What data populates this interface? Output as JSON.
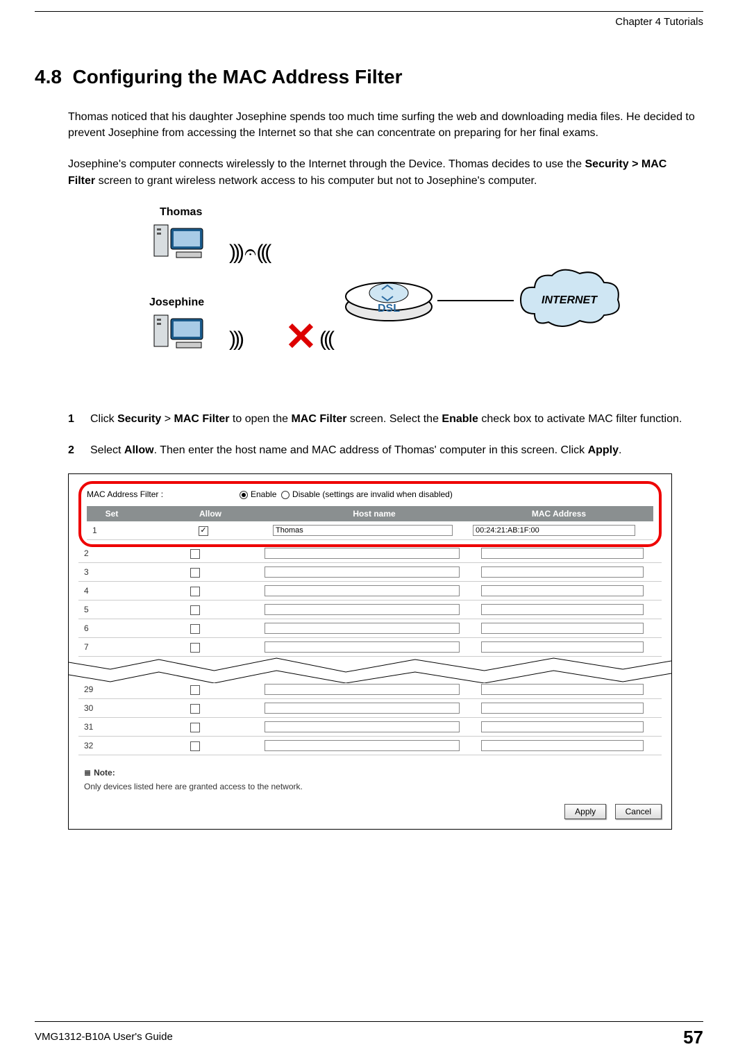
{
  "header": {
    "chapter": "Chapter 4 Tutorials"
  },
  "section": {
    "number": "4.8",
    "title": "Configuring the MAC Address Filter"
  },
  "para1_a": "Thomas noticed that his daughter Josephine spends too much time surfing the web and downloading media files. He decided to prevent Josephine from accessing the Internet so that she can concentrate on preparing for her final exams.",
  "para2_a": "Josephine's computer connects wirelessly to the Internet through the Device. Thomas decides to use the ",
  "para2_bold": "Security > MAC Filter",
  "para2_b": " screen to grant wireless network access to his computer but not to Josephine's computer.",
  "diagram": {
    "label_thomas": "Thomas",
    "label_josephine": "Josephine",
    "dsl_label": "DSL",
    "cloud_label": "INTERNET"
  },
  "steps": {
    "s1": {
      "num": "1",
      "a": "Click ",
      "b1": "Security",
      "mid1": " > ",
      "b2": "MAC Filter",
      "c": " to open the ",
      "b3": "MAC Filter",
      "d": " screen. Select the ",
      "b4": "Enable",
      "e": " check box to activate MAC filter function."
    },
    "s2": {
      "num": "2",
      "a": "Select ",
      "b1": "Allow",
      "b": ". Then enter the host name and MAC address of Thomas' computer in this screen. Click ",
      "b2": "Apply",
      "c": "."
    }
  },
  "panel": {
    "filter_label": "MAC Address Filter :",
    "enable": "Enable",
    "disable": "Disable (settings are invalid when disabled)",
    "head_set": "Set",
    "head_allow": "Allow",
    "head_host": "Host name",
    "head_mac": "MAC Address",
    "rows_top": [
      {
        "set": "1",
        "allow": true,
        "host": "Thomas",
        "mac": "00:24:21:AB:1F:00"
      },
      {
        "set": "2",
        "allow": false,
        "host": "",
        "mac": ""
      },
      {
        "set": "3",
        "allow": false,
        "host": "",
        "mac": ""
      },
      {
        "set": "4",
        "allow": false,
        "host": "",
        "mac": ""
      },
      {
        "set": "5",
        "allow": false,
        "host": "",
        "mac": ""
      },
      {
        "set": "6",
        "allow": false,
        "host": "",
        "mac": ""
      },
      {
        "set": "7",
        "allow": false,
        "host": "",
        "mac": ""
      }
    ],
    "rows_bottom": [
      {
        "set": "29",
        "allow": false,
        "host": "",
        "mac": ""
      },
      {
        "set": "30",
        "allow": false,
        "host": "",
        "mac": ""
      },
      {
        "set": "31",
        "allow": false,
        "host": "",
        "mac": ""
      },
      {
        "set": "32",
        "allow": false,
        "host": "",
        "mac": ""
      }
    ],
    "note_title": "Note:",
    "note_body": "Only devices listed here are granted access to the network.",
    "btn_apply": "Apply",
    "btn_cancel": "Cancel"
  },
  "footer": {
    "guide": "VMG1312-B10A User's Guide",
    "page": "57"
  }
}
